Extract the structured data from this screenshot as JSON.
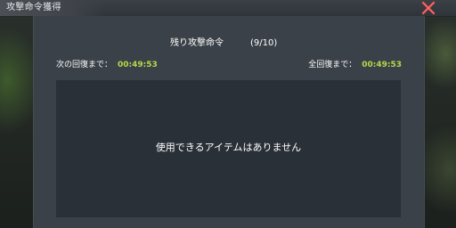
{
  "window": {
    "title": "攻撃命令獲得",
    "close_icon": "close-icon"
  },
  "recovery": {
    "label": "残り攻撃命令",
    "count": "(9/10)",
    "next_label": "次の回復まで：",
    "next_time": "00:49:53",
    "full_label": "全回復まで：",
    "full_time": "00:49:53"
  },
  "items": {
    "empty_message": "使用できるアイテムはありません"
  },
  "colors": {
    "panel": "#3b4148",
    "item_area": "#2a3037",
    "timer_value": "#b8d84a",
    "close_icon": "#e04848"
  }
}
